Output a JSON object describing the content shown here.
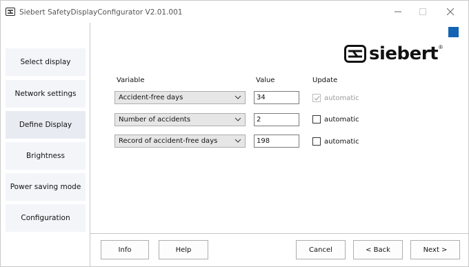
{
  "window": {
    "title": "Siebert SafetyDisplayConfigurator V2.01.001",
    "controls": {
      "minimize": "—",
      "maximize": "☐",
      "close": "✕"
    }
  },
  "sidebar": {
    "items": [
      {
        "label": "Select display",
        "active": false
      },
      {
        "label": "Network settings",
        "active": false
      },
      {
        "label": "Define Display",
        "active": true
      },
      {
        "label": "Brightness",
        "active": false
      },
      {
        "label": "Power saving mode",
        "active": false
      },
      {
        "label": "Configuration",
        "active": false
      }
    ]
  },
  "logo": {
    "text": "siebert",
    "reg": "®",
    "icon": "siebert-logo-icon"
  },
  "accent_color": "#1464b4",
  "table": {
    "headers": {
      "variable": "Variable",
      "value": "Value",
      "update": "Update"
    },
    "rows": [
      {
        "variable": "Accident-free days",
        "value": "34",
        "update_label": "automatic",
        "checked": true,
        "disabled": true
      },
      {
        "variable": "Number of accidents",
        "value": "2",
        "update_label": "automatic",
        "checked": false,
        "disabled": false
      },
      {
        "variable": "Record of accident-free days",
        "value": "198",
        "update_label": "automatic",
        "checked": false,
        "disabled": false
      }
    ]
  },
  "footer": {
    "info": "Info",
    "help": "Help",
    "cancel": "Cancel",
    "back": "< Back",
    "next": "Next >"
  }
}
